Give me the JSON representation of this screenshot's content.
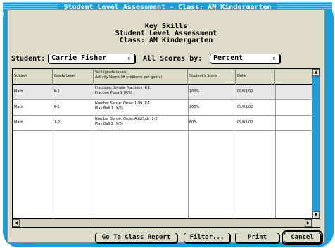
{
  "window": {
    "title": "Student Level Assessment - Class: AM Kindergarten",
    "heading_line1": "Key Skills",
    "heading_line2": "Student Level Assessment",
    "heading_line3": "Class: AM Kindergarten"
  },
  "controls": {
    "student_label": "Student:",
    "student_value": "Carrie Fisher",
    "scores_label": "All Scores by:",
    "scores_value": "Percent",
    "popup_arrows": "⇕"
  },
  "table": {
    "headers": {
      "subject": "Subject",
      "grade_level": "Grade Level",
      "skill_line1": "Skill (grade levels)",
      "skill_line2": "Activity Name (# problems per game)",
      "score": "Student's Score",
      "date": "Date"
    },
    "rows": [
      {
        "subject": "Math",
        "grade": "K-1",
        "skill": "Fractions: Simple Fractions (K-1)",
        "activity": "Fraction Pizza 1 (X/5)",
        "score": "100%",
        "date": "09/03/02"
      },
      {
        "subject": "Math",
        "grade": "K-1",
        "skill": "Number Sense: Order 1-99 (K-1)",
        "activity": "Play Ball 1 (X/5)",
        "score": "100%",
        "date": "09/03/02"
      },
      {
        "subject": "Math",
        "grade": "1-2",
        "skill": "Number Sense: Order/Add/Sub (1-2)",
        "activity": "Play Ball 2 (X/5)",
        "score": "60%",
        "date": "09/03/02"
      }
    ]
  },
  "buttons": {
    "class_report": "Go To Class Report",
    "filter": "Filter...",
    "print": "Print",
    "cancel": "Cancel"
  },
  "colors": {
    "frame": "#1aa0d8",
    "window": "#dcdcc8"
  }
}
